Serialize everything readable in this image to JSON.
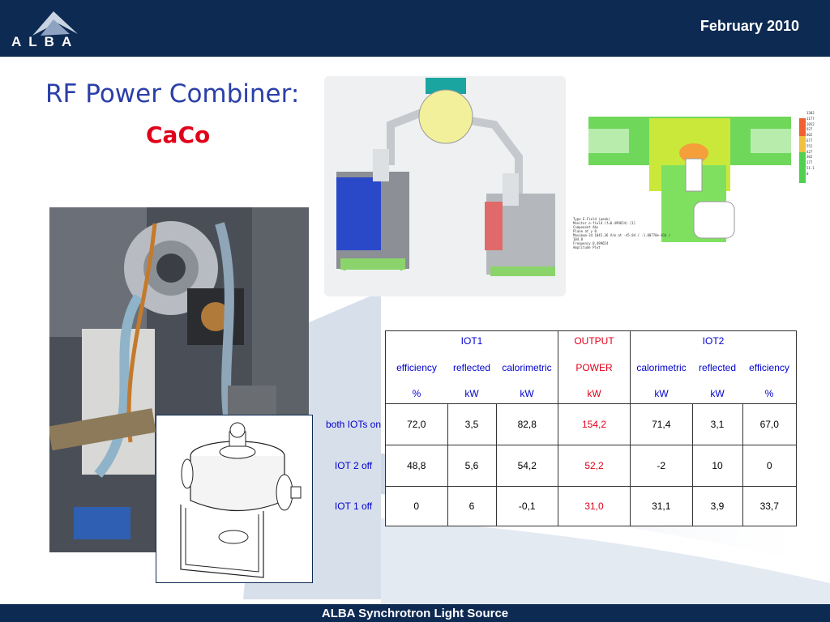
{
  "header": {
    "logo_text": "ALBA",
    "date": "February 2010"
  },
  "title": {
    "main": "RF Power Combiner:",
    "sub": "CaCo"
  },
  "simulation": {
    "legend_lines": [
      "Type        E-Field (peak)",
      "Monitor     e-field (f=0.499654) [1]",
      "Component   Abs",
      "Plane at y  0",
      "Maximum-2d  1045.36 V/m at -45.84 / -1.80770e-014 / 104.8",
      "Frequency   0.499654",
      "Amplitude Plot"
    ],
    "scale_values": [
      "1302",
      "1177",
      "1052",
      "927",
      "802",
      "677",
      "552",
      "427",
      "302",
      "177",
      "51.1",
      "0"
    ]
  },
  "table": {
    "header_group": [
      "IOT1",
      "OUTPUT",
      "IOT2"
    ],
    "header_names": [
      "efficiency",
      "reflected",
      "calorimetric",
      "POWER",
      "calorimetric",
      "reflected",
      "efficiency"
    ],
    "header_units": [
      "%",
      "kW",
      "kW",
      "kW",
      "kW",
      "kW",
      "%"
    ],
    "rows": [
      {
        "label": "both IOTs on",
        "values": [
          "72,0",
          "3,5",
          "82,8",
          "154,2",
          "71,4",
          "3,1",
          "67,0"
        ]
      },
      {
        "label": "IOT 2 off",
        "values": [
          "48,8",
          "5,6",
          "54,2",
          "52,2",
          "-2",
          "10",
          "0"
        ]
      },
      {
        "label": "IOT 1 off",
        "values": [
          "0",
          "6",
          "-0,1",
          "31,0",
          "31,1",
          "3,9",
          "33,7"
        ]
      }
    ]
  },
  "footer": {
    "text": "ALBA Synchrotron Light Source"
  },
  "colors": {
    "bar": "#0d2a52",
    "title": "#2b3fa8",
    "accent_red": "#e0001a"
  }
}
